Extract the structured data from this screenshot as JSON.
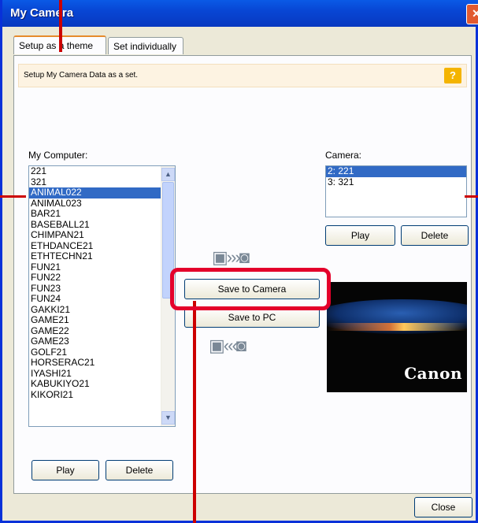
{
  "window": {
    "title": "My Camera"
  },
  "tabs": [
    {
      "label": "Setup as a theme",
      "active": true
    },
    {
      "label": "Set individually",
      "active": false
    }
  ],
  "info": {
    "text": "Setup My Camera Data as a set.",
    "help_label": "?"
  },
  "computer": {
    "label": "My Computer:",
    "items": [
      "221",
      "321",
      "ANIMAL022",
      "ANIMAL023",
      "BAR21",
      "BASEBALL21",
      "CHIMPAN21",
      "ETHDANCE21",
      "ETHTECHN21",
      "FUN21",
      "FUN22",
      "FUN23",
      "FUN24",
      "GAKKI21",
      "GAME21",
      "GAME22",
      "GAME23",
      "GOLF21",
      "HORSERAC21",
      "IYASHI21",
      "KABUKIYO21",
      "KIKORI21"
    ],
    "selected_index": 2,
    "play_label": "Play",
    "delete_label": "Delete"
  },
  "camera": {
    "label": "Camera:",
    "items": [
      "2: 221",
      "3: 321"
    ],
    "selected_index": 0,
    "play_label": "Play",
    "delete_label": "Delete"
  },
  "transfer": {
    "save_to_camera_label": "Save to Camera",
    "save_to_pc_label": "Save to PC"
  },
  "preview": {
    "logo_text": "Canon"
  },
  "footer": {
    "close_label": "Close"
  },
  "colors": {
    "accent": "#316ac5",
    "callout": "#e4002b",
    "titlebar": "#0a5ae6"
  },
  "icons": [
    "close-icon",
    "help-icon",
    "pc-to-camera-icon",
    "camera-to-pc-icon",
    "scroll-up-icon",
    "scroll-down-icon"
  ]
}
